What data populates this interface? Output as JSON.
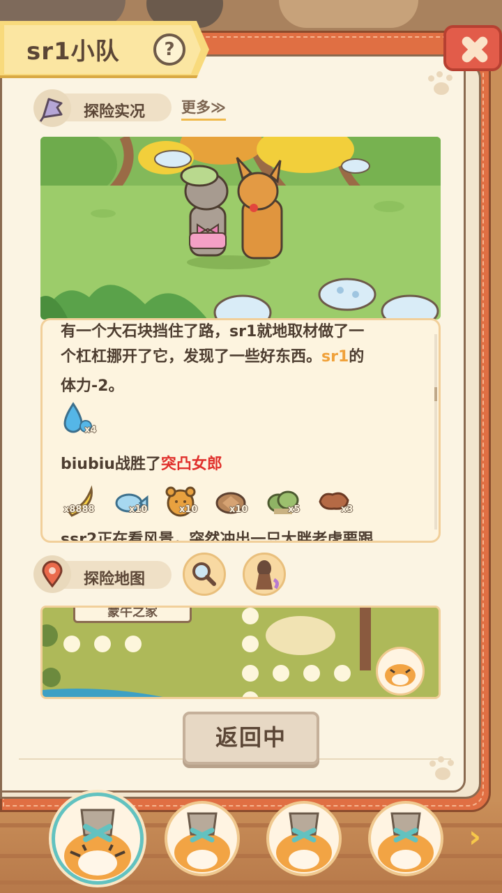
{
  "window": {
    "title": "sr1小队",
    "help_label": "?",
    "close_label": ""
  },
  "exploration_log": {
    "section_label": "探险实况",
    "more_label": "更多≫",
    "entries": [
      {
        "text_parts": [
          "有一个大石块挡住了路，sr1就地取材做了一",
          "个杠杠挪开了它，发现了一些好东西。",
          "sr1",
          "的",
          "体力-2。"
        ]
      },
      {
        "text_parts": [
          "biubiu战胜了",
          "突凸女郎"
        ]
      },
      {
        "text_parts": [
          "ssr2正在看风景，突然冲出一只大胖老虎要跟"
        ]
      }
    ],
    "reward_1": [
      {
        "icon": "water-drop-icon",
        "qty": "x4"
      }
    ],
    "reward_2": [
      {
        "icon": "banana-icon",
        "qty": "x8888"
      },
      {
        "icon": "fish-icon",
        "qty": "x10"
      },
      {
        "icon": "bear-cookie-icon",
        "qty": "x10"
      },
      {
        "icon": "turtle-shell-icon",
        "qty": "x10"
      },
      {
        "icon": "leaf-pile-icon",
        "qty": "x5"
      },
      {
        "icon": "meat-icon",
        "qty": "x3"
      }
    ]
  },
  "exploration_map": {
    "section_label": "探险地图",
    "location_sign": "蒙牛之家"
  },
  "back_button": {
    "label": "返回中"
  },
  "team_avatars": [
    {
      "name": "tiger-avatar-1",
      "active": true
    },
    {
      "name": "tiger-avatar-2",
      "active": false
    },
    {
      "name": "tiger-avatar-3",
      "active": false
    },
    {
      "name": "tiger-avatar-4",
      "active": false
    }
  ],
  "colors": {
    "accent": "#f0a13a",
    "highlight_red": "#e0302c",
    "book_cover": "#e06f43",
    "page": "#fbf4e3"
  }
}
